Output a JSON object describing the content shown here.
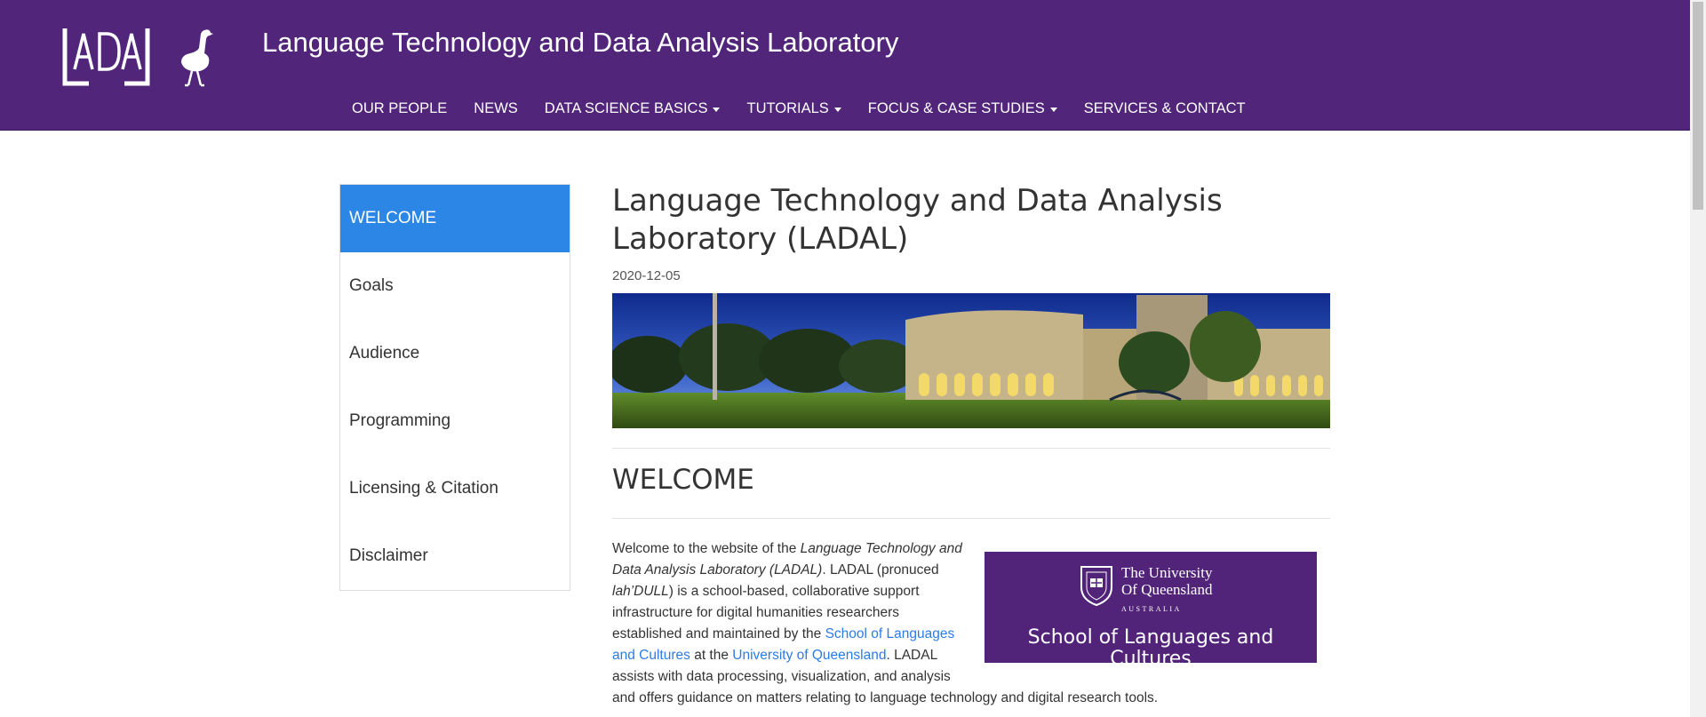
{
  "header": {
    "logo_text": "LADAL",
    "site_title": "Language Technology and Data Analysis Laboratory"
  },
  "nav": {
    "items": [
      {
        "label": "OUR PEOPLE",
        "dropdown": false
      },
      {
        "label": "NEWS",
        "dropdown": false
      },
      {
        "label": "DATA SCIENCE BASICS",
        "dropdown": true
      },
      {
        "label": "TUTORIALS",
        "dropdown": true
      },
      {
        "label": "FOCUS & CASE STUDIES",
        "dropdown": true
      },
      {
        "label": "SERVICES & CONTACT",
        "dropdown": false
      }
    ]
  },
  "toc": {
    "items": [
      {
        "label": "WELCOME",
        "active": true
      },
      {
        "label": "Goals",
        "active": false
      },
      {
        "label": "Audience",
        "active": false
      },
      {
        "label": "Programming",
        "active": false
      },
      {
        "label": "Licensing & Citation",
        "active": false
      },
      {
        "label": "Disclaimer",
        "active": false
      }
    ]
  },
  "main": {
    "title": "Language Technology and Data Analysis Laboratory (LADAL)",
    "date": "2020-12-05",
    "section_title": "WELCOME",
    "intro": {
      "t1": "Welcome to the website of the ",
      "t2_italic": "Language Technology and Data Analysis Laboratory (LADAL)",
      "t3": ". LADAL (pronuced ",
      "t4_italic": "lah’DULL",
      "t5": ") is a school-based, collaborative support infrastructure for digital humanities researchers established and maintained by the ",
      "link1": "School of Languages and Cultures",
      "t6": " at the ",
      "link2": "University of Queensland",
      "t7": ". LADAL assists with data processing, visualization, and analysis and offers guidance on matters relating to language technology and digital research tools."
    },
    "uq_box": {
      "name_line1": "The University",
      "name_line2": "Of Queensland",
      "country": "AUSTRALIA",
      "school": "School of Languages and Cultures"
    }
  },
  "colors": {
    "header_bg": "#51257a",
    "toc_active_bg": "#2c86e6",
    "link": "#2c7be5",
    "uq_purple": "#51247a"
  }
}
